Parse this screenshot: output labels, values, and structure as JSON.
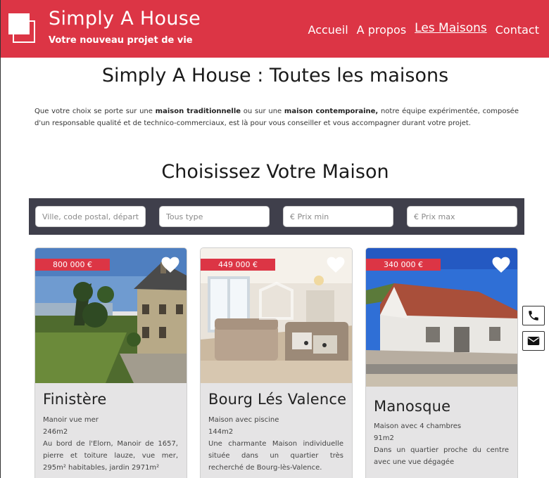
{
  "colors": {
    "brand": "#dc3545",
    "search_bg": "#3f3f4b",
    "card_bg": "#e5e4e5"
  },
  "header": {
    "title": "Simply A House",
    "subtitle": "Votre nouveau projet de vie",
    "logo_icon": "two-squares-logo"
  },
  "nav": {
    "items": [
      {
        "label": "Accueil"
      },
      {
        "label": "A propos"
      },
      {
        "label": "Les Maisons",
        "active": true
      },
      {
        "label": "Contact"
      }
    ]
  },
  "intro": {
    "title": "Simply A House : Toutes les maisons",
    "text_1": "Que votre choix se porte sur une ",
    "bold_1": "maison traditionnelle",
    "text_2": " ou sur une ",
    "bold_2": "maison contemporaine,",
    "text_3": " notre équipe expérimentée, composée d'un responsable qualité et de technico-commerciaux, est là pour vous conseiller et vous accompagner durant votre projet."
  },
  "section_title": "Choisissez Votre Maison",
  "search": {
    "location_placeholder": "Ville, code postal, département",
    "type_placeholder": "Tous type",
    "price_min_placeholder": "€ Prix min",
    "price_max_placeholder": "€ Prix max"
  },
  "cards": [
    {
      "price": "800 000 €",
      "city": "Finistère",
      "line_1": "Manoir vue mer",
      "line_2": "246m2",
      "line_3": "Au bord de l'Elorn, Manoir de 1657, pierre et toiture lauze, vue mer, 295m² habitables, jardin 2971m²"
    },
    {
      "price": "449 000 €",
      "city": "Bourg Lés Valence",
      "line_1": "Maison avec piscine",
      "line_2": "144m2",
      "line_3": "Une charmante Maison individuelle située dans un quartier très recherché de Bourg-lès-Valence."
    },
    {
      "price": "340 000 €",
      "city": "Manosque",
      "line_1": "Maison avec 4 chambres",
      "line_2": "91m2",
      "line_3": "Dans un quartier proche du centre avec une vue dégagée"
    }
  ],
  "side_buttons": {
    "phone_icon": "phone-icon",
    "mail_icon": "envelope-icon"
  }
}
